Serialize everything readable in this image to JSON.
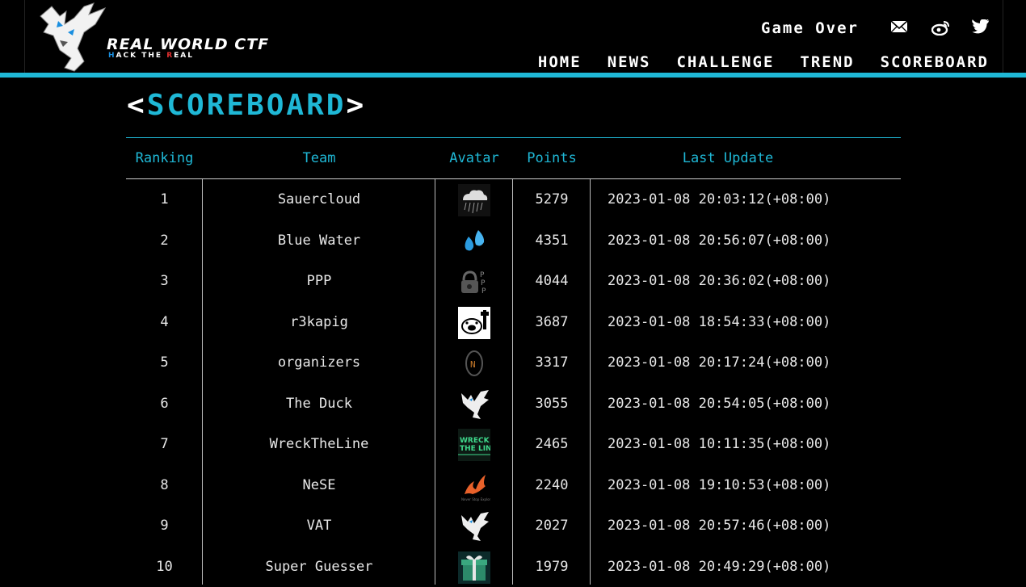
{
  "header": {
    "logo_title": "REAL WORLD CTF",
    "logo_sub_1": "H",
    "logo_sub_2": "ACK THE ",
    "logo_sub_3": "R",
    "logo_sub_4": "EAL",
    "game_over": "Game Over",
    "social_icons": [
      "mail-icon",
      "weibo-icon",
      "twitter-icon"
    ],
    "nav": [
      "HOME",
      "NEWS",
      "CHALLENGE",
      "TREND",
      "SCOREBOARD"
    ]
  },
  "page_title": {
    "open": "<",
    "word": "SCOREBOARD",
    "close": ">"
  },
  "table": {
    "headers": [
      "Ranking",
      "Team",
      "Avatar",
      "Points",
      "Last Update"
    ],
    "rows": [
      {
        "rank": "1",
        "team": "Sauercloud",
        "points": "5279",
        "updated": "2023-01-08 20:03:12(+08:00)",
        "avatar": "cloud-avatar"
      },
      {
        "rank": "2",
        "team": "Blue Water",
        "points": "4351",
        "updated": "2023-01-08 20:56:07(+08:00)",
        "avatar": "water-drops-avatar"
      },
      {
        "rank": "3",
        "team": "PPP",
        "points": "4044",
        "updated": "2023-01-08 20:36:02(+08:00)",
        "avatar": "padlock-avatar"
      },
      {
        "rank": "4",
        "team": "r3kapig",
        "points": "3687",
        "updated": "2023-01-08 18:54:33(+08:00)",
        "avatar": "pig-avatar"
      },
      {
        "rank": "5",
        "team": "organizers",
        "points": "3317",
        "updated": "2023-01-08 20:17:24(+08:00)",
        "avatar": "organizers-avatar"
      },
      {
        "rank": "6",
        "team": "The Duck",
        "points": "3055",
        "updated": "2023-01-08 20:54:05(+08:00)",
        "avatar": "dragon-avatar"
      },
      {
        "rank": "7",
        "team": "WreckTheLine",
        "points": "2465",
        "updated": "2023-01-08 10:11:35(+08:00)",
        "avatar": "wrecktheline-avatar"
      },
      {
        "rank": "8",
        "team": "NeSE",
        "points": "2240",
        "updated": "2023-01-08 19:10:53(+08:00)",
        "avatar": "phoenix-avatar"
      },
      {
        "rank": "9",
        "team": "VAT",
        "points": "2027",
        "updated": "2023-01-08 20:57:46(+08:00)",
        "avatar": "dragon-avatar"
      },
      {
        "rank": "10",
        "team": "Super Guesser",
        "points": "1979",
        "updated": "2023-01-08 20:49:29(+08:00)",
        "avatar": "gift-box-avatar"
      }
    ]
  },
  "colors": {
    "accent": "#1fb8d6",
    "background": "#000000",
    "text": "#e8e8e8"
  }
}
